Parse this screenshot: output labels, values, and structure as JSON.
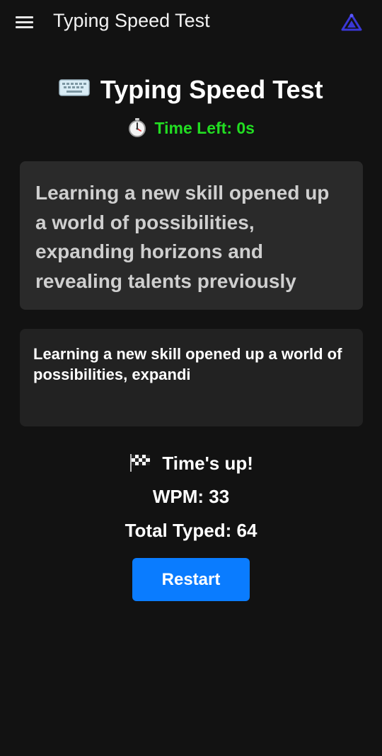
{
  "app_bar": {
    "title": "Typing Speed Test",
    "menu_icon": "hamburger-menu-icon",
    "logo_icon": "brand-logo-icon",
    "logo_color": "#3a37d6"
  },
  "heading": {
    "icon": "keyboard-icon",
    "text": "Typing Speed Test"
  },
  "timer": {
    "icon": "stopwatch-icon",
    "label": "Time Left: 0s",
    "color": "#22dd22"
  },
  "passage": {
    "text": "Learning a new skill opened up a world of possibilities, expanding horizons and revealing talents previously"
  },
  "typed_input": {
    "value": "Learning a new skill opened up a world of possibilities, expandi"
  },
  "results": {
    "status_icon": "checkered-flag-icon",
    "status": "Time's up!",
    "wpm": "WPM: 33",
    "total_typed": "Total Typed: 64"
  },
  "restart_button": {
    "label": "Restart",
    "color": "#0a7cff"
  }
}
